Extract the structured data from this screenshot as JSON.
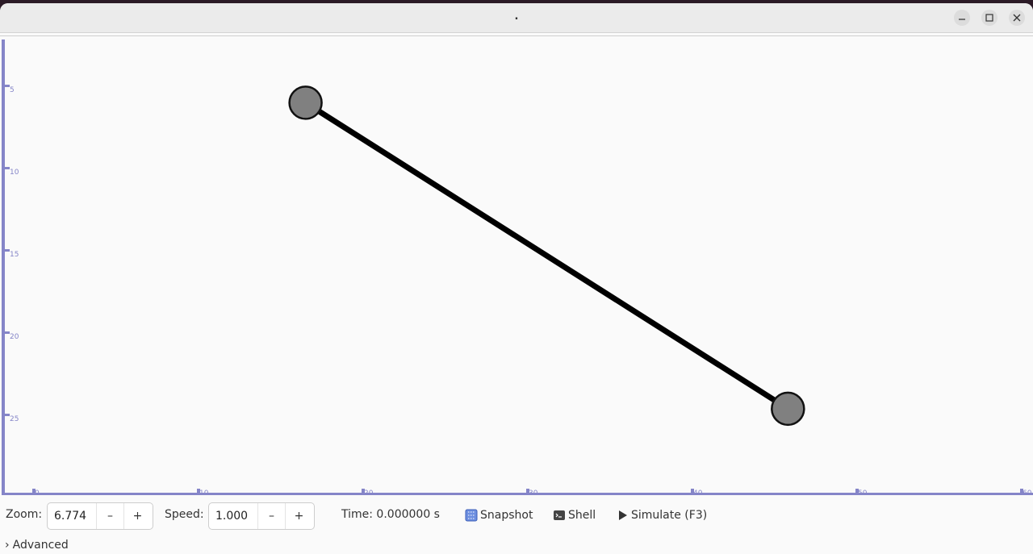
{
  "window": {
    "title": "."
  },
  "toolbar": {
    "zoom_label": "Zoom:",
    "zoom_value": "6.774",
    "speed_label": "Speed:",
    "speed_value": "1.000",
    "time_text": "Time: 0.000000 s",
    "snapshot_label": "Snapshot",
    "shell_label": "Shell",
    "simulate_label": "Simulate (F3)",
    "minus_glyph": "–",
    "plus_glyph": "+"
  },
  "advanced": {
    "label": "Advanced",
    "chevron": "›"
  },
  "ruler": {
    "x_ticks": [
      "0",
      "10",
      "20",
      "30",
      "40",
      "50",
      "60"
    ],
    "y_ticks": [
      "5",
      "10",
      "15",
      "20",
      "25"
    ]
  },
  "scene": {
    "nodes": [
      {
        "x": 16.5,
        "y": 6
      },
      {
        "x": 45.8,
        "y": 24.6
      }
    ],
    "node_color": "#808080",
    "link_color": "#000000",
    "ruler_color": "#8585c8"
  },
  "icons": {
    "minimize": "minimize-icon",
    "maximize": "maximize-icon",
    "close": "close-icon",
    "snapshot": "snapshot-icon",
    "shell": "terminal-icon",
    "simulate": "play-icon"
  }
}
